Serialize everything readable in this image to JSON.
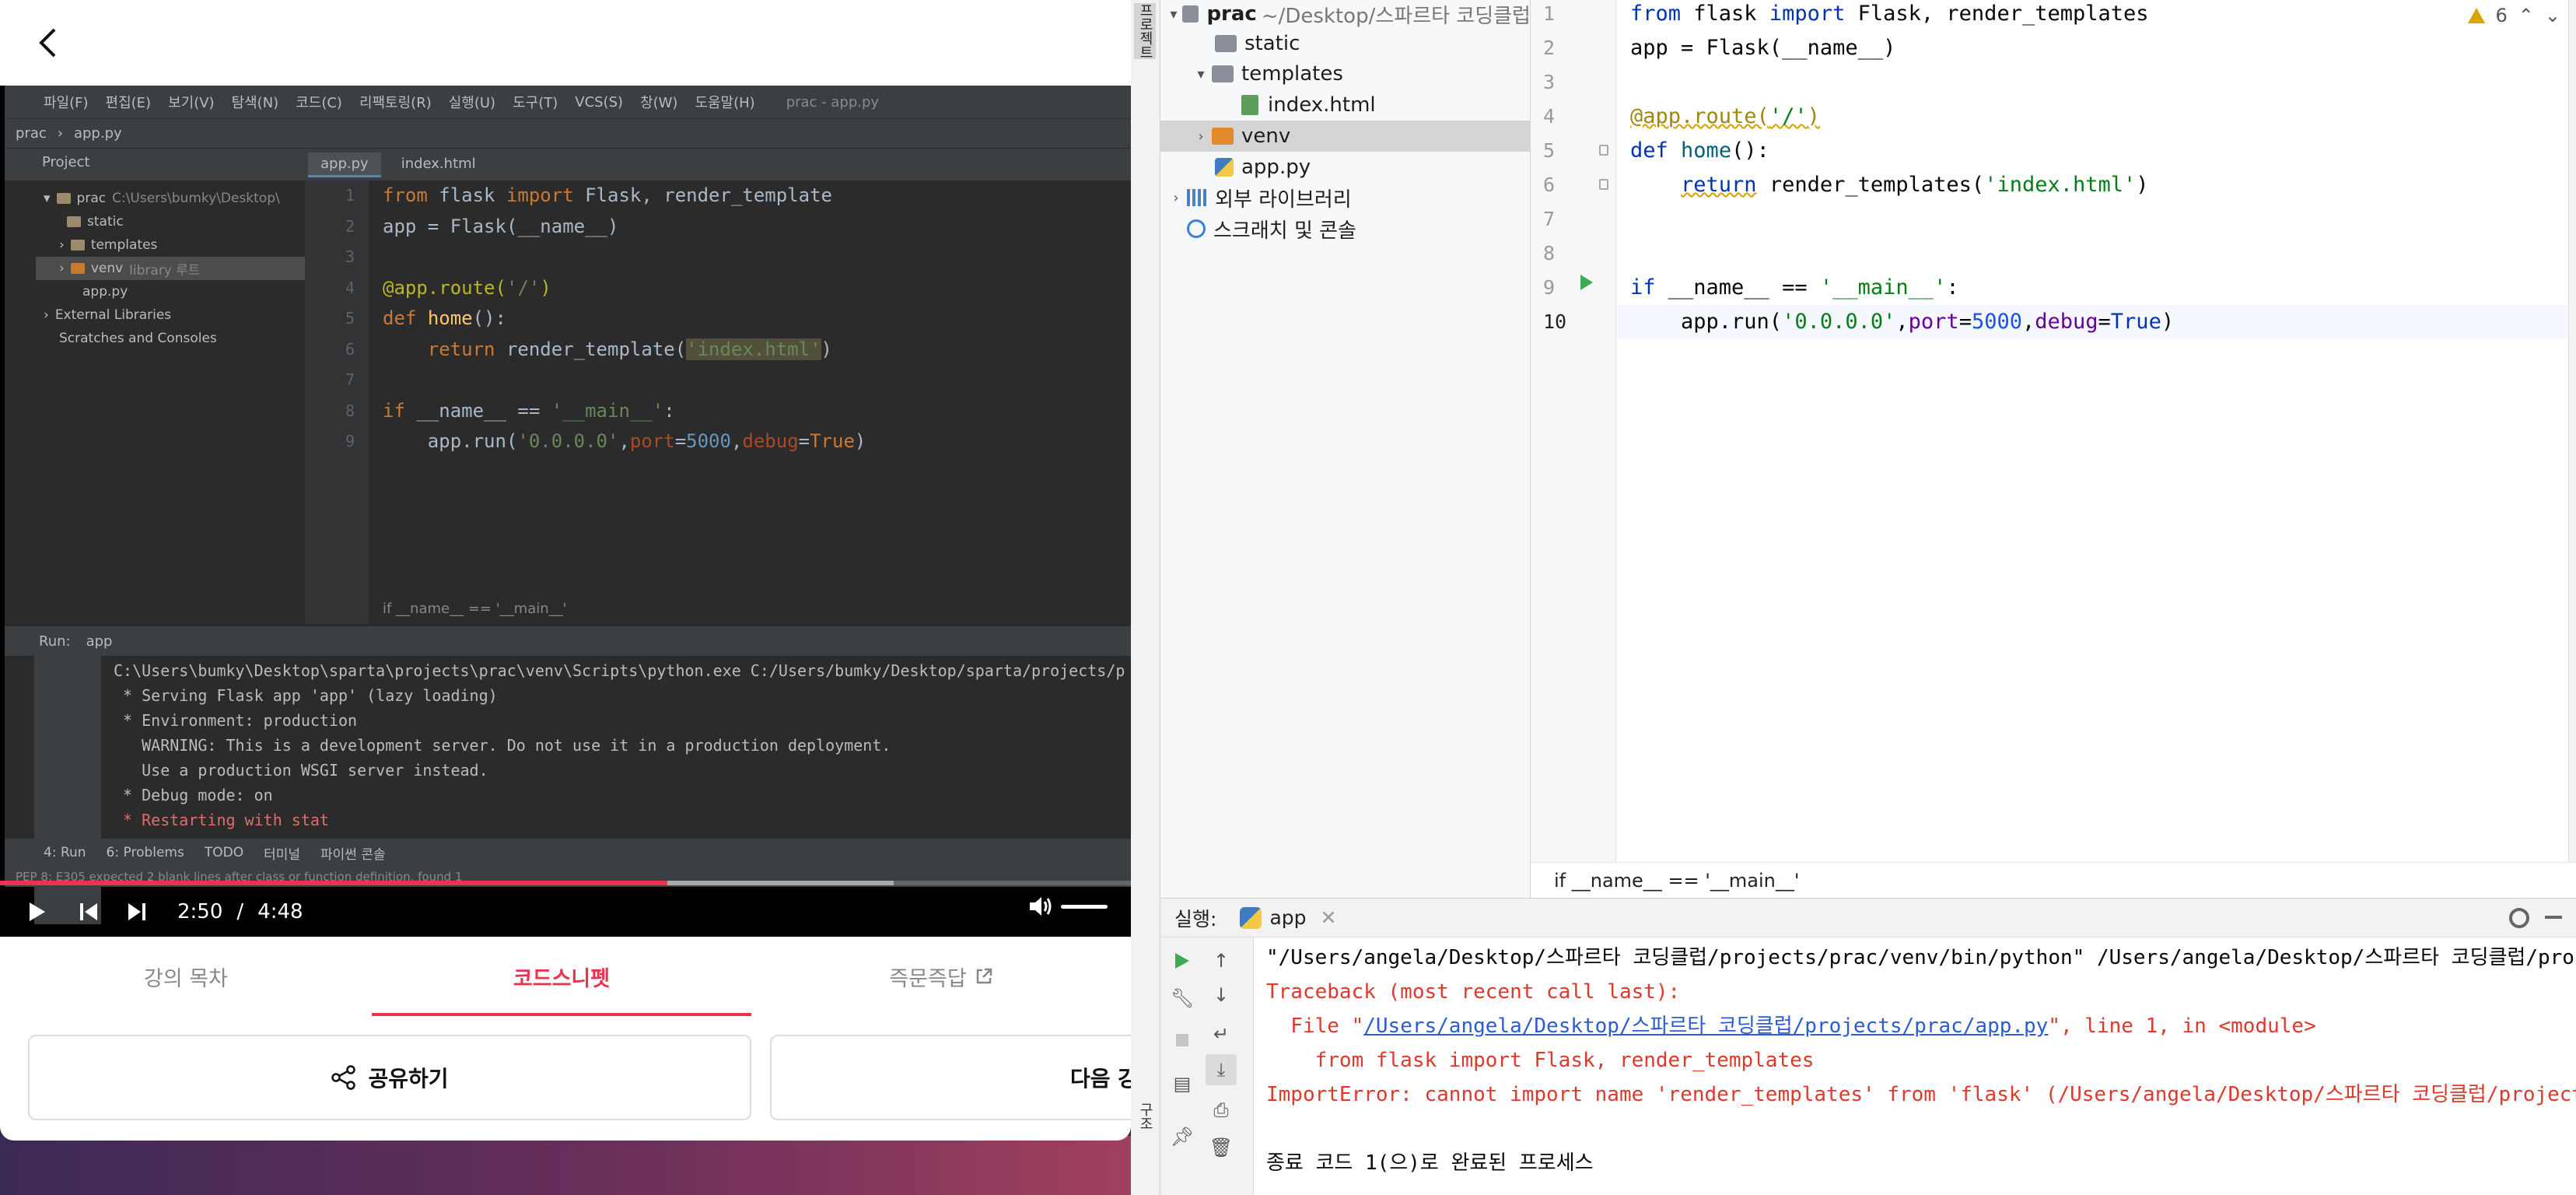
{
  "browser": {
    "tabs": [
      {
        "label": "강의 목차"
      },
      {
        "label": "코드스니펫"
      },
      {
        "label": "즉문즉답"
      }
    ],
    "share_label": "공유하기",
    "next_label": "다음 강"
  },
  "video": {
    "current_time": "2:50",
    "separator": "/",
    "duration": "4:48",
    "progress": 0.59,
    "buffered": 0.79,
    "ide": {
      "menu": [
        "파일(F)",
        "편집(E)",
        "보기(V)",
        "탐색(N)",
        "코드(C)",
        "리팩토링(R)",
        "실행(U)",
        "도구(T)",
        "VCS(S)",
        "창(W)",
        "도움말(H)"
      ],
      "window_title": "prac - app.py",
      "path": [
        "prac",
        "app.py"
      ],
      "project_label": "Project",
      "tabs": [
        "app.py",
        "index.html"
      ],
      "tree": [
        {
          "label": "prac",
          "extra": "C:\\Users\\bumky\\Desktop\\"
        },
        {
          "label": "static"
        },
        {
          "label": "templates"
        },
        {
          "label": "venv",
          "extra": "library 루트"
        },
        {
          "label": "app.py"
        },
        {
          "label": "External Libraries"
        },
        {
          "label": "Scratches and Consoles"
        }
      ],
      "line_numbers": [
        "1",
        "2",
        "3",
        "4",
        "5",
        "6",
        "7",
        "8",
        "9"
      ],
      "breadcrumb": "if __name__ == '__main__'",
      "run_label": "Run:",
      "run_tab": "app",
      "console": [
        "C:\\Users\\bumky\\Desktop\\sparta\\projects\\prac\\venv\\Scripts\\python.exe C:/Users/bumky/Desktop/sparta/projects/p",
        " * Serving Flask app 'app' (lazy loading)",
        " * Environment: production",
        "   WARNING: This is a development server. Do not use it in a production deployment.",
        "   Use a production WSGI server instead.",
        " * Debug mode: on",
        " * Restarting with stat"
      ],
      "bottom_tabs": [
        "4: Run",
        "6: Problems",
        "TODO",
        "터미널",
        "파이썬 콘솔"
      ],
      "status": "PEP 8: E305 expected 2 blank lines after class or function definition, found 1"
    }
  },
  "ide": {
    "sidebar_strip_label": "프로젝트",
    "structure_strip_label": "구조",
    "tree": [
      {
        "label": "prac",
        "extra": "~/Desktop/스파르타 코딩클럽"
      },
      {
        "label": "static"
      },
      {
        "label": "templates"
      },
      {
        "label": "index.html"
      },
      {
        "label": "venv"
      },
      {
        "label": "app.py"
      },
      {
        "label": "외부 라이브러리"
      },
      {
        "label": "스크래치 및 콘솔"
      }
    ],
    "warning_count": "6",
    "line_numbers": [
      "1",
      "2",
      "3",
      "4",
      "5",
      "6",
      "7",
      "8",
      "9",
      "10"
    ],
    "breadcrumb": "if __name__ == '__main__'",
    "run_label": "실행:",
    "run_tab": "app",
    "console": {
      "command": "\"/Users/angela/Desktop/스파르타 코딩클럽/projects/prac/venv/bin/python\" /Users/angela/Desktop/스파르타 코딩클럽/projects/prac/app.py",
      "traceback": "Traceback (most recent call last):",
      "file_prefix": "  File \"",
      "file_link": "/Users/angela/Desktop/스파르타 코딩클럽/projects/prac/app.py",
      "file_suffix": "\", line 1, in <module>",
      "code_line": "    from flask import Flask, render_templates",
      "error": "ImportError: cannot import name 'render_templates' from 'flask' (/Users/angela/Desktop/스파르타 코딩클럽/projects/prac/venv/lib/python3.8/site-packages/flask/__init__.py)",
      "exit": "종료 코드 1(으)로 완료된 프로세스"
    }
  }
}
